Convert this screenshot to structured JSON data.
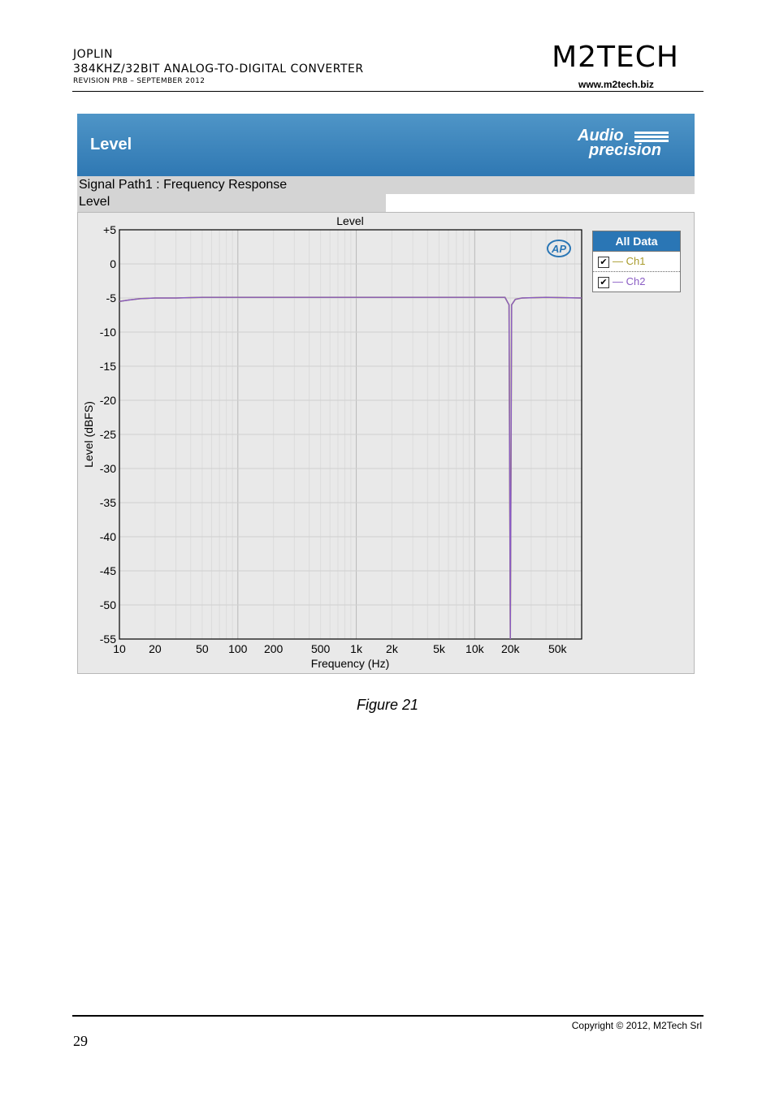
{
  "header": {
    "title": "JOPLIN",
    "subtitle": "384kHz/32bit analog-to-digital converter",
    "revision": "Revision PrB – September 2012",
    "brand": "M2TECH",
    "url": "www.m2tech.biz"
  },
  "panel": {
    "banner_title": "Level",
    "logo_line1": "Audio",
    "logo_line2": "precision",
    "signal_path": "Signal Path1 : Frequency Response",
    "measurement": "Level",
    "ap_badge": "AP"
  },
  "legend": {
    "header": "All Data",
    "items": [
      {
        "label": "— Ch1",
        "color": "#a89a2a",
        "checked": true
      },
      {
        "label": "— Ch2",
        "color": "#8a5cc4",
        "checked": true
      }
    ]
  },
  "chart_data": {
    "type": "line",
    "title": "Level",
    "xlabel": "Frequency (Hz)",
    "ylabel": "Level (dBFS)",
    "xscale": "log",
    "xlim": [
      10,
      80000
    ],
    "ylim": [
      -55,
      5
    ],
    "x_ticks": [
      10,
      20,
      50,
      100,
      200,
      500,
      1000,
      2000,
      5000,
      10000,
      20000,
      50000
    ],
    "x_tick_labels": [
      "10",
      "20",
      "50",
      "100",
      "200",
      "500",
      "1k",
      "2k",
      "5k",
      "10k",
      "20k",
      "50k"
    ],
    "y_ticks": [
      5,
      0,
      -5,
      -10,
      -15,
      -20,
      -25,
      -30,
      -35,
      -40,
      -45,
      -50,
      -55
    ],
    "y_tick_labels": [
      "+5",
      "0",
      "-5",
      "-10",
      "-15",
      "-20",
      "-25",
      "-30",
      "-35",
      "-40",
      "-45",
      "-50",
      "-55"
    ],
    "grid": true,
    "legend_position": "right",
    "series": [
      {
        "name": "Ch1",
        "color": "#a89a2a",
        "x": [
          10,
          12,
          15,
          20,
          30,
          50,
          100,
          1000,
          10000,
          18000,
          19500,
          20000,
          20500,
          22000,
          25000,
          40000,
          80000
        ],
        "y": [
          -5.5,
          -5.3,
          -5.1,
          -5.0,
          -5.0,
          -4.9,
          -4.9,
          -4.9,
          -4.9,
          -4.9,
          -6,
          -55,
          -6,
          -5.2,
          -5.0,
          -4.9,
          -5.0
        ]
      },
      {
        "name": "Ch2",
        "color": "#8a5cc4",
        "x": [
          10,
          12,
          15,
          20,
          30,
          50,
          100,
          1000,
          10000,
          18000,
          19500,
          20000,
          20500,
          22000,
          25000,
          40000,
          80000
        ],
        "y": [
          -5.5,
          -5.3,
          -5.1,
          -5.0,
          -5.0,
          -4.9,
          -4.9,
          -4.9,
          -4.9,
          -4.9,
          -6,
          -55,
          -6,
          -5.2,
          -5.0,
          -4.9,
          -5.0
        ]
      }
    ]
  },
  "caption": "Figure 21",
  "footer": {
    "copyright": "Copyright © 2012, M2Tech Srl",
    "page_number": "29"
  }
}
